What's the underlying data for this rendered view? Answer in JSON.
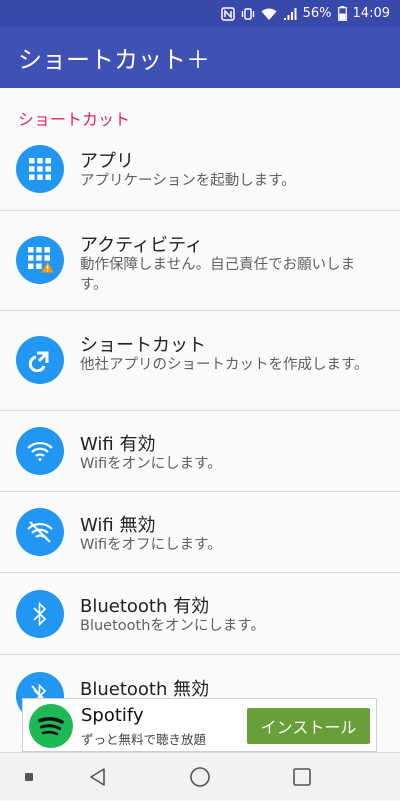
{
  "status_bar": {
    "battery": "56%",
    "time": "14:09",
    "icons": [
      "nfc-icon",
      "vibrate-icon",
      "wifi-icon",
      "signal-icon",
      "battery-icon"
    ]
  },
  "app_bar": {
    "title": "ショートカット＋"
  },
  "section": {
    "title": "ショートカット"
  },
  "items": [
    {
      "title": "アプリ",
      "subtitle": "アプリケーションを起動します。",
      "icon": "app-grid-icon"
    },
    {
      "title": "アクティビティ",
      "subtitle": "動作保障しません。自己責任でお願いします。",
      "icon": "activity-grid-warning-icon"
    },
    {
      "title": "ショートカット",
      "subtitle": "他社アプリのショートカットを作成します。",
      "icon": "shortcut-arrow-icon"
    },
    {
      "title": "Wifi 有効",
      "subtitle": "Wifiをオンにします。",
      "icon": "wifi-on-icon"
    },
    {
      "title": "Wifi 無効",
      "subtitle": "Wifiをオフにします。",
      "icon": "wifi-off-icon"
    },
    {
      "title": "Bluetooth 有効",
      "subtitle": "Bluetoothをオンにします。",
      "icon": "bluetooth-on-icon"
    },
    {
      "title": "Bluetooth 無効",
      "subtitle": "",
      "icon": "bluetooth-off-icon"
    }
  ],
  "ad": {
    "name": "Spotify",
    "tagline": "ずっと無料で聴き放題",
    "install_label": "インストール",
    "brand_color": "#1db954",
    "button_color": "#689f38"
  },
  "colors": {
    "primary": "#3f51b5",
    "primary_dark": "#3949ab",
    "accent": "#e91e63",
    "icon_bg": "#2196f3"
  }
}
